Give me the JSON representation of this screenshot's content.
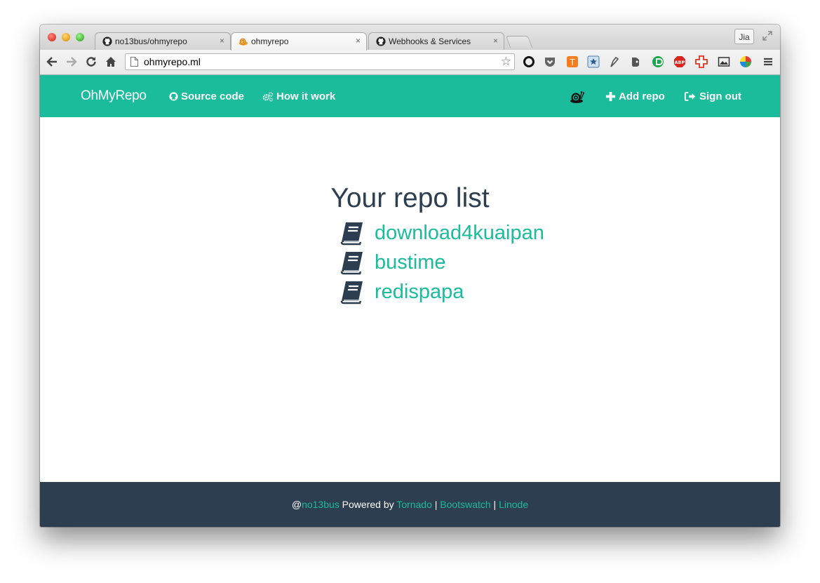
{
  "browser": {
    "tabs": [
      {
        "title": "no13bus/ohmyrepo",
        "icon": "github-icon",
        "active": false
      },
      {
        "title": "ohmyrepo",
        "icon": "snail-icon",
        "active": true
      },
      {
        "title": "Webhooks & Services",
        "icon": "github-icon",
        "active": false
      }
    ],
    "tab_close_glyph": "×",
    "profile_name": "Jia",
    "url": "ohmyrepo.ml"
  },
  "navbar": {
    "brand": "OhMyRepo",
    "source_code": "Source code",
    "how_it_work": "How it work",
    "add_repo": "Add repo",
    "sign_out": "Sign out"
  },
  "main": {
    "title": "Your repo list",
    "repos": [
      "download4kuaipan",
      "bustime",
      "redispapa"
    ]
  },
  "footer": {
    "at": "@",
    "user": "no13bus",
    "powered_by": " Powered by ",
    "tornado": "Tornado",
    "sep": " | ",
    "bootswatch": "Bootswatch",
    "linode": "Linode"
  },
  "colors": {
    "accent": "#1abc9c",
    "dark": "#2c3e50"
  }
}
